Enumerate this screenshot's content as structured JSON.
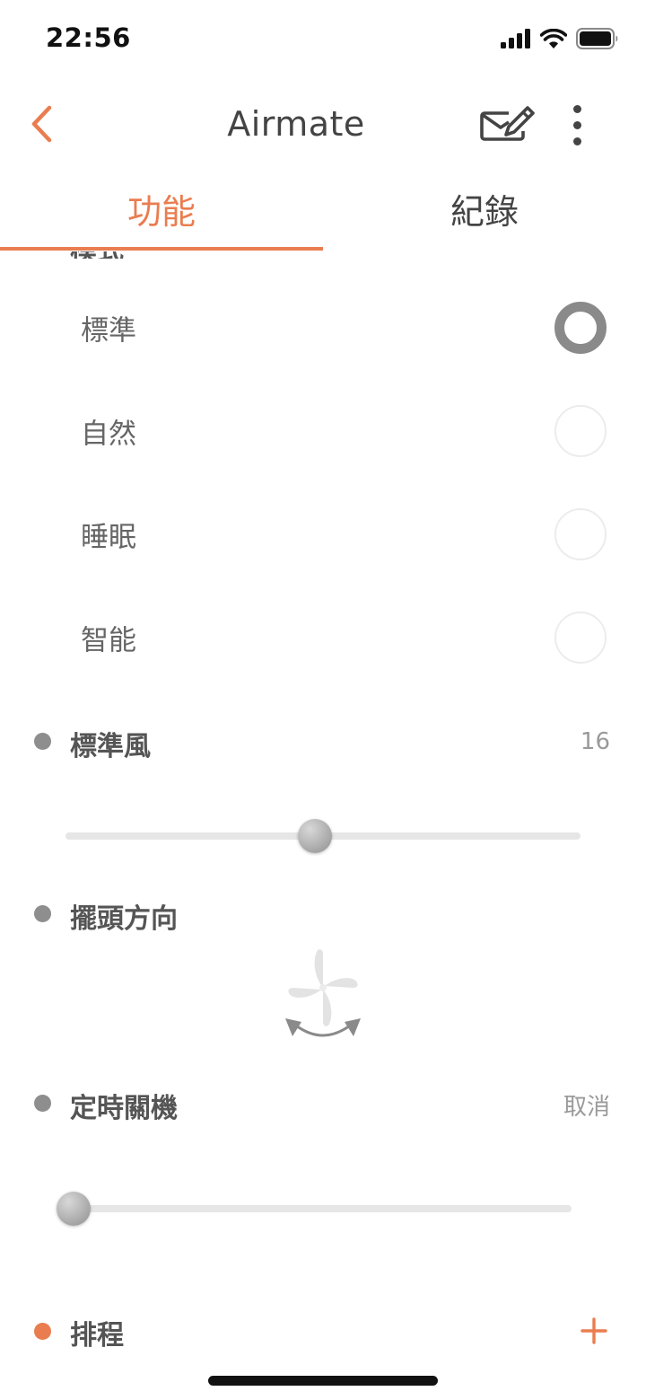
{
  "status_bar": {
    "time": "22:56"
  },
  "header": {
    "title": "Airmate"
  },
  "tabs": [
    {
      "label": "功能",
      "active": true
    },
    {
      "label": "紀錄",
      "active": false
    }
  ],
  "mode": {
    "heading_cutoff": "模式",
    "options": [
      {
        "label": "標準",
        "selected": true
      },
      {
        "label": "自然",
        "selected": false
      },
      {
        "label": "睡眠",
        "selected": false
      },
      {
        "label": "智能",
        "selected": false
      }
    ]
  },
  "wind": {
    "title": "標準風",
    "value": "16",
    "slider_fraction": 0.485
  },
  "oscillation": {
    "title": "擺頭方向",
    "icon": "fan-oscillation-icon"
  },
  "timer": {
    "title": "定時關機",
    "cancel_label": "取消",
    "slider_fraction": 0.0
  },
  "schedule": {
    "title": "排程",
    "add_icon": "plus-icon"
  },
  "colors": {
    "accent": "#ea7d4f",
    "text": "#555555",
    "muted": "#9a9a9a",
    "track": "#e6e6e6",
    "radio_on": "#8a8a8a"
  }
}
